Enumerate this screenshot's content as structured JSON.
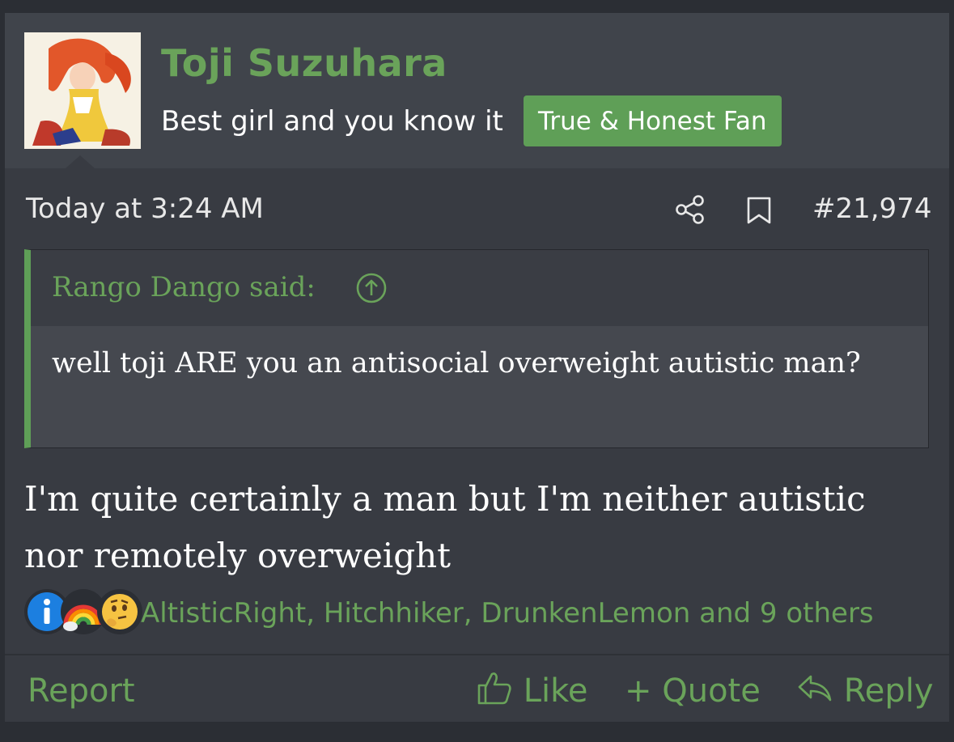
{
  "user": {
    "name": "Toji Suzuhara",
    "title": "Best girl and you know it",
    "banner": "True & Honest Fan",
    "avatar_icon": "anime-avatar"
  },
  "post": {
    "date": "Today at 3:24 AM",
    "number": "#21,974",
    "share_icon": "share-icon",
    "bookmark_icon": "bookmark-icon"
  },
  "quote": {
    "author": "Rango Dango said:",
    "text": "well toji ARE you an antisocial overweight autistic man?"
  },
  "message": "I'm quite certainly a man but I'm neither autistic nor remotely overweight",
  "reactions": {
    "icons": [
      "info-icon",
      "rainbow-icon",
      "thinking-face-icon"
    ],
    "text": "AltisticRight, Hitchhiker, DrunkenLemon and 9 others"
  },
  "actions": {
    "report": "Report",
    "like": "Like",
    "quote": "Quote",
    "reply": "Reply"
  },
  "colors": {
    "accent": "#6aa35a",
    "badge": "#5f9f57",
    "post_bg": "#383b42",
    "header_bg": "#40444b"
  }
}
